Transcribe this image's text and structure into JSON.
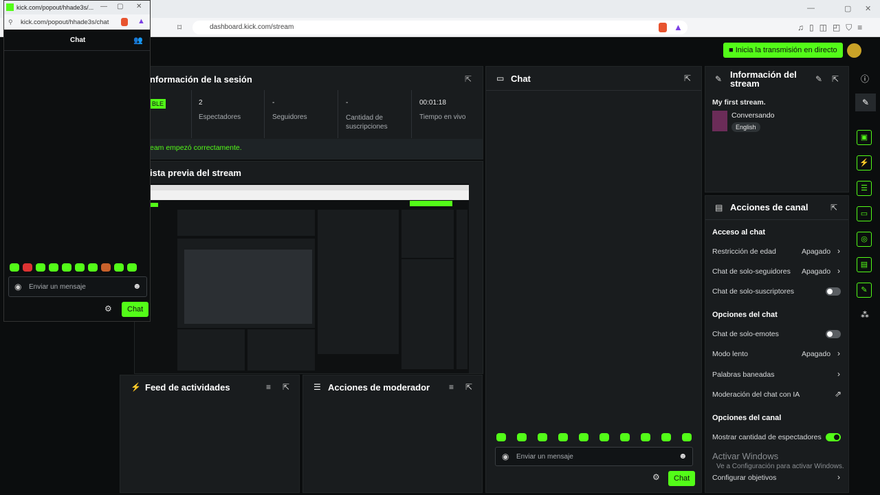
{
  "browser": {
    "url": "dashboard.kick.com/stream"
  },
  "popup": {
    "tab_title": "kick.com/popout/hhade3s/...",
    "url": "kick.com/popout/hhade3s/chat",
    "chat_title": "Chat",
    "input_placeholder": "Enviar un mensaje",
    "send_label": "Chat"
  },
  "header": {
    "go_live": "Inicia la transmisión en directo"
  },
  "session": {
    "title": "nformación de la sesión",
    "badge": "BLE",
    "stats": [
      {
        "value": "2",
        "label": "Espectadores"
      },
      {
        "value": "-",
        "label": "Seguidores"
      },
      {
        "value": "-",
        "label": "Cantidad de suscripciones"
      },
      {
        "value": "00:01:18",
        "label": "Tiempo en vivo"
      }
    ],
    "status": "eam empezó correctamente."
  },
  "preview": {
    "title": "ista previa del stream"
  },
  "activity": {
    "title": "Feed de actividades"
  },
  "moderator": {
    "title": "Acciones de moderador"
  },
  "chat": {
    "title": "Chat",
    "input_placeholder": "Enviar un mensaje",
    "send_label": "Chat"
  },
  "stream_info": {
    "title": "Información del stream",
    "stream_title": "My first stream.",
    "category": "Conversando",
    "language": "English"
  },
  "channel": {
    "title": "Acciones de canal",
    "access_heading": "Acceso al chat",
    "age": "Restricción de edad",
    "age_value": "Apagado",
    "followers": "Chat de solo-seguidores",
    "followers_value": "Apagado",
    "subs": "Chat de solo-suscriptores",
    "chat_opts_heading": "Opciones del chat",
    "emotes": "Chat de solo-emotes",
    "slow": "Modo lento",
    "slow_value": "Apagado",
    "banned": "Palabras baneadas",
    "ai_mod": "Moderación del chat con IA",
    "channel_opts_heading": "Opciones del canal",
    "viewer_count": "Mostrar cantidad de espectadores",
    "goals": "Configurar objetivos"
  },
  "watermark": {
    "line1": "Activar Windows",
    "line2": "Ve a Configuración para activar Windows."
  }
}
